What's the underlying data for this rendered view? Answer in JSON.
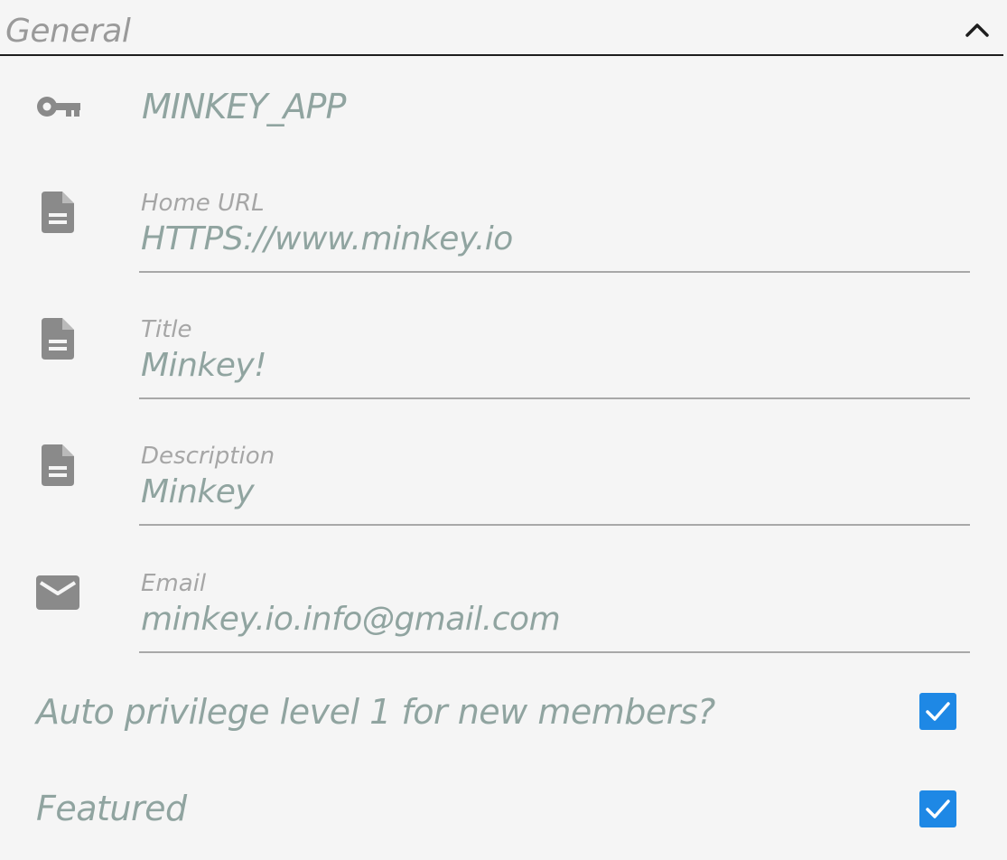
{
  "section": {
    "title": "General",
    "toggle_icon": "chevron-up-icon"
  },
  "app": {
    "icon": "key-icon",
    "identifier": "MINKEY_APP"
  },
  "fields": {
    "home_url": {
      "icon": "document-icon",
      "label": "Home URL",
      "value": "HTTPS://www.minkey.io"
    },
    "title": {
      "icon": "document-icon",
      "label": "Title",
      "value": "Minkey!"
    },
    "description": {
      "icon": "document-icon",
      "label": "Description",
      "value": "Minkey"
    },
    "email": {
      "icon": "mail-icon",
      "label": "Email",
      "value": "minkey.io.info@gmail.com"
    }
  },
  "options": {
    "auto_privilege": {
      "label": "Auto privilege level 1 for new members?",
      "checked": true
    },
    "featured": {
      "label": "Featured",
      "checked": true
    }
  },
  "colors": {
    "accent": "#1e88e5",
    "value_text": "#90a4a0",
    "label_text": "#a6a6a6",
    "icon": "#8a8a8a"
  }
}
